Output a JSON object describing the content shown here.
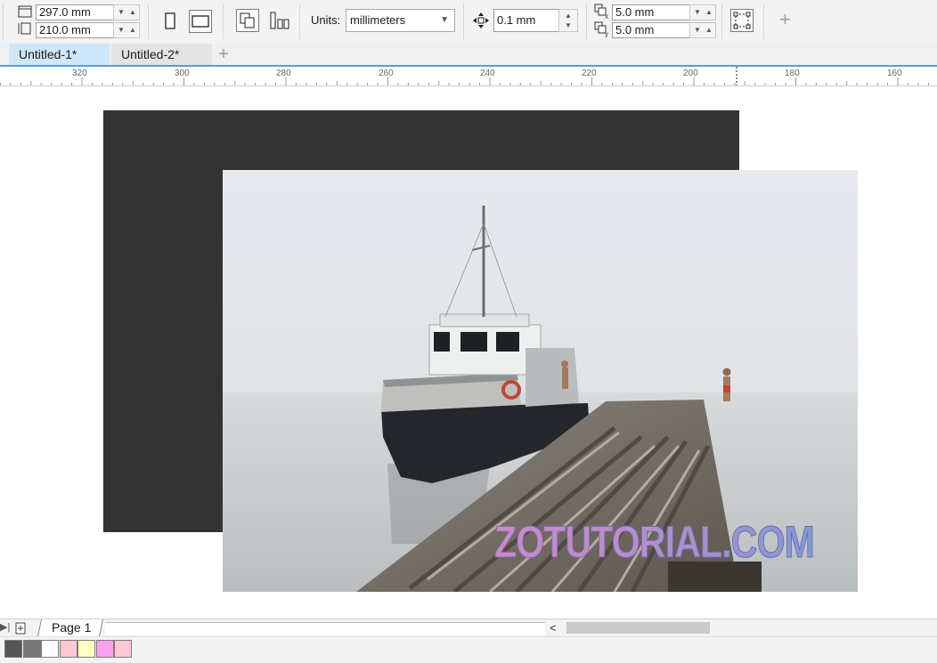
{
  "property_bar": {
    "page_width": "297.0 mm",
    "page_height": "210.0 mm",
    "units_label": "Units:",
    "units_value": "millimeters",
    "nudge_value": "0.1 mm",
    "duplicate_x": "5.0 mm",
    "duplicate_y": "5.0 mm",
    "icons": [
      "page-width-icon",
      "page-height-icon",
      "portrait-icon",
      "landscape-icon",
      "all-pages-icon",
      "current-page-icon",
      "nudge-icon",
      "duplicate-x-icon",
      "duplicate-y-icon",
      "treat-as-filled-icon",
      "add-icon"
    ]
  },
  "tabs": [
    {
      "label": "Untitled-1*",
      "active": true
    },
    {
      "label": "Untitled-2*",
      "active": false
    }
  ],
  "ruler": {
    "labels": [
      "320",
      "300",
      "280",
      "260",
      "240",
      "220",
      "200",
      "180",
      "160"
    ]
  },
  "canvas": {
    "watermark": "ZOTUTORIAL.COM",
    "background_rect_color": "#333333",
    "photo_subject": "boat-at-foggy-pier"
  },
  "page_nav": {
    "page_label": "Page 1"
  },
  "palette": {
    "colors": [
      "#555555",
      "#777777",
      "#ffffff",
      "#ffc8d0",
      "#ffffc0",
      "#ff9ff0",
      "#ffc8d8"
    ]
  },
  "accent": "#4da3d8"
}
